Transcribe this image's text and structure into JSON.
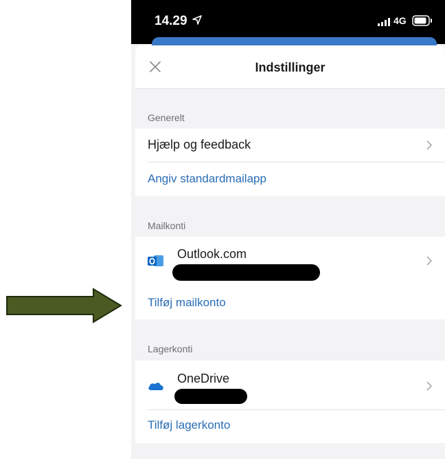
{
  "statusbar": {
    "time": "14.29",
    "network": "4G",
    "location_icon": "location-arrow-icon",
    "signal_icon": "signal-bars-icon",
    "battery_icon": "battery-icon"
  },
  "header": {
    "title": "Indstillinger",
    "close_icon": "close-icon"
  },
  "sections": {
    "general": {
      "label": "Generelt",
      "help_label": "Hjælp og feedback",
      "default_mail_link": "Angiv standardmailapp"
    },
    "mail_accounts": {
      "label": "Mailkonti",
      "account_name": "Outlook.com",
      "account_icon": "outlook-icon",
      "add_link": "Tilføj mailkonto"
    },
    "storage_accounts": {
      "label": "Lagerkonti",
      "account_name": "OneDrive",
      "account_icon": "onedrive-cloud-icon",
      "add_link": "Tilføj lagerkonto"
    }
  },
  "annotation": {
    "arrow_icon": "pointer-arrow-icon",
    "arrow_color": "#4b5a22"
  },
  "colors": {
    "accent": "#2a6db5",
    "outlook_blue": "#0a64c2",
    "onedrive_blue": "#1b72d0"
  }
}
